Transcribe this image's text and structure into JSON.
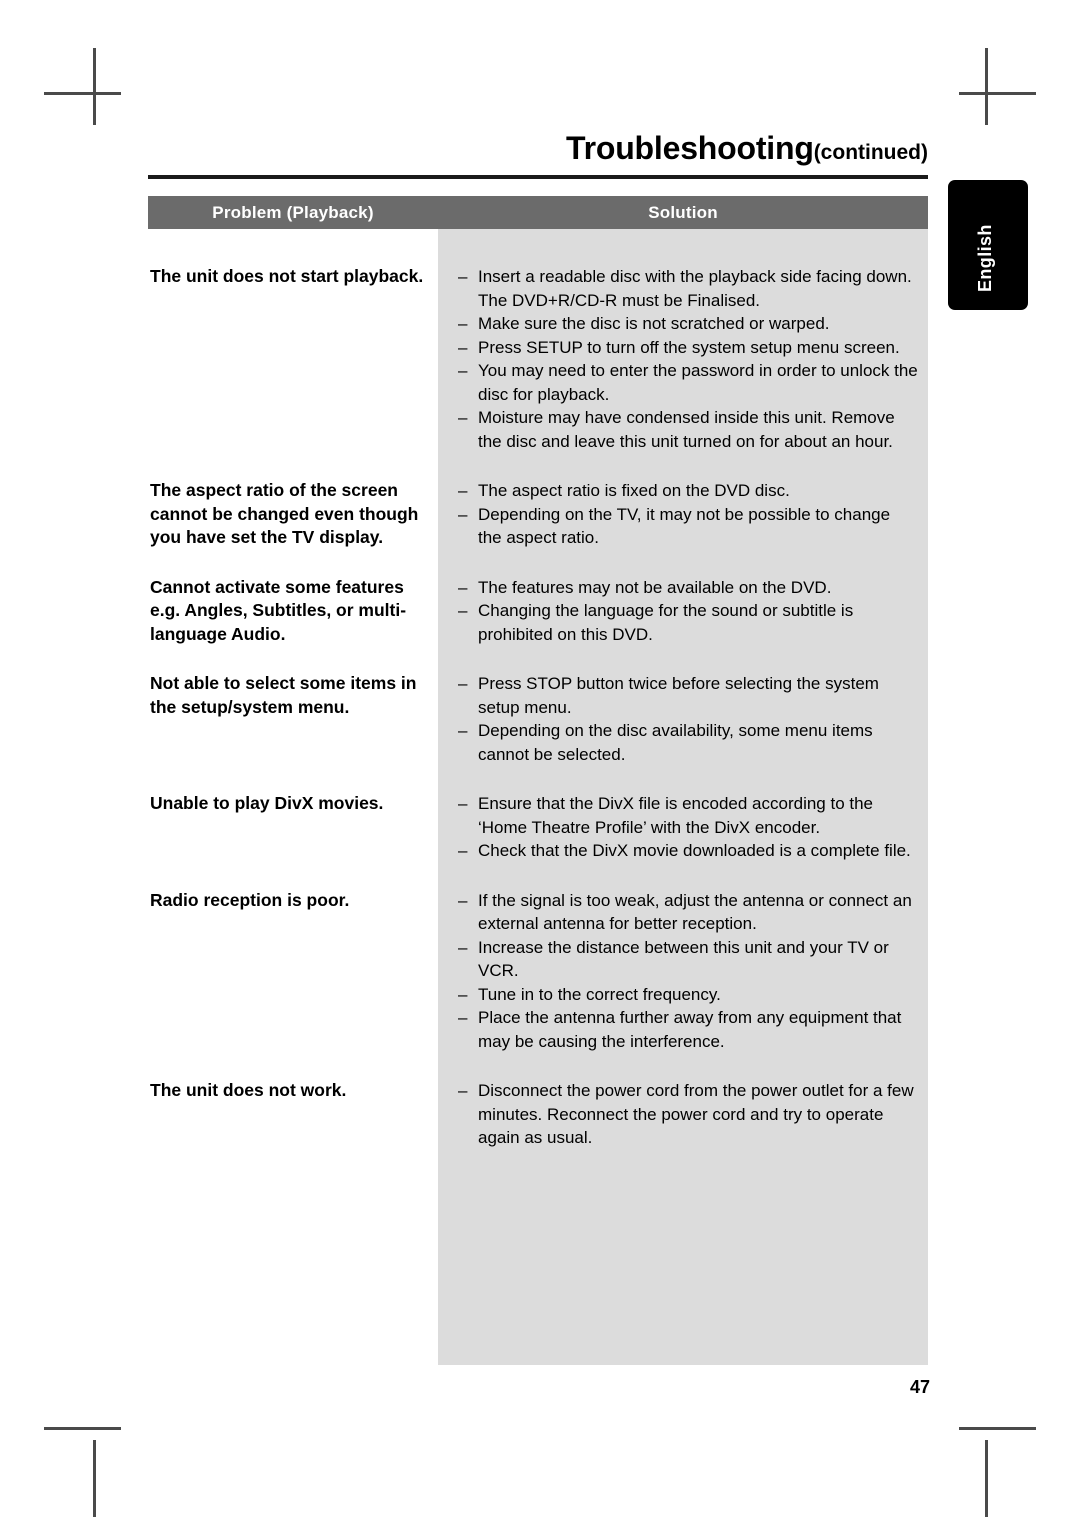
{
  "page": {
    "title": "Troubleshooting",
    "title_suffix": "(continued)",
    "number": "47",
    "language_tab": "English"
  },
  "table": {
    "header": {
      "problem": "Problem (Playback)",
      "solution": "Solution"
    },
    "dash": "–",
    "rows": [
      {
        "problem": "The unit does not start playback.",
        "solutions": [
          "Insert a readable disc with the playback side facing down. The DVD+R/CD-R must be Finalised.",
          "Make sure the disc is not scratched or warped.",
          "Press SETUP to turn off the system setup menu screen.",
          "You may need to enter the password in order to unlock the disc for playback.",
          "Moisture may have condensed inside this unit. Remove the disc and leave this unit turned on for about an hour."
        ]
      },
      {
        "problem": "The aspect ratio of the screen cannot be changed even though you have set the TV display.",
        "solutions": [
          "The aspect ratio is fixed on the DVD disc.",
          "Depending on the TV, it may not be possible to change the aspect ratio."
        ]
      },
      {
        "problem": "Cannot activate some features e.g. Angles, Subtitles, or multi-language Audio.",
        "solutions": [
          "The features may not be available on the DVD.",
          "Changing the language for the sound or subtitle is prohibited on this DVD."
        ]
      },
      {
        "problem": "Not able to select some items in the setup/system menu.",
        "solutions": [
          "Press STOP button twice before selecting the system setup menu.",
          "Depending on the disc availability, some menu items cannot be selected."
        ]
      },
      {
        "problem": "Unable to play DivX movies.",
        "solutions": [
          "Ensure that the DivX file is encoded according to the ‘Home Theatre Profile’ with the DivX encoder.",
          "Check that the DivX movie downloaded is a complete file."
        ]
      },
      {
        "problem": "Radio reception is poor.",
        "solutions": [
          "If the signal is too weak, adjust the antenna or connect an external antenna for better reception.",
          "Increase the distance between this unit and your TV or VCR.",
          "Tune in to the correct frequency.",
          "Place the antenna further away from any equipment that may be causing the interference."
        ]
      },
      {
        "problem": "The unit does not work.",
        "solutions": [
          "Disconnect the power cord from the power outlet for a few minutes. Reconnect the power cord and try to operate again as usual."
        ]
      }
    ]
  },
  "colors": {
    "header_bg": "#6b6b6b",
    "solution_bg": "#dcdcdc",
    "tab_bg": "#000000",
    "rule": "#1a1a1a"
  }
}
